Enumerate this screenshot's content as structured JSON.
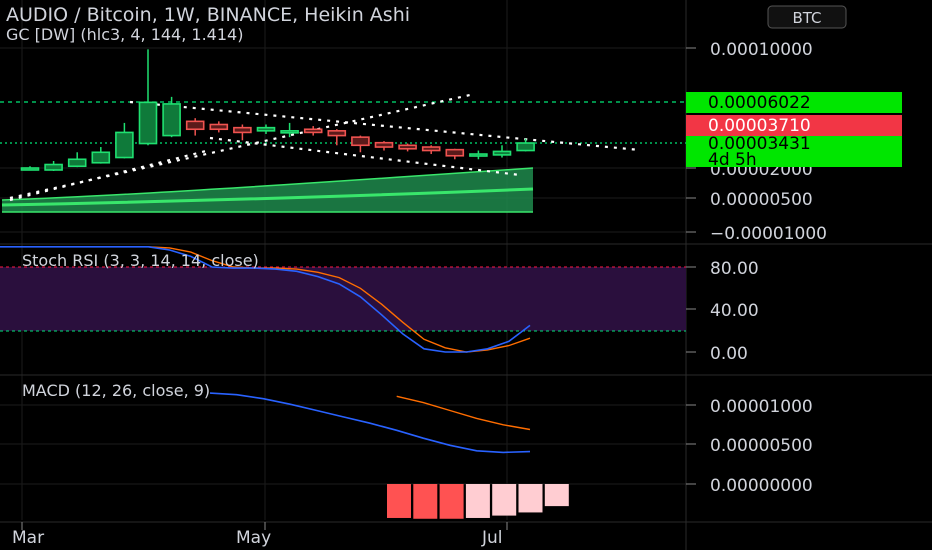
{
  "header": {
    "title": "AUDIO / Bitcoin, 1W, BINANCE, Heikin Ashi",
    "indicator": "GC [DW] (hlc3, 4, 144, 1.414)",
    "currency_button": "BTC"
  },
  "colors": {
    "background": "#000000",
    "up": "#26a69a",
    "down": "#ef5350",
    "guppy_band": "#1f8a4c",
    "guppy_line": "#39e66b",
    "stoch_k": "#2962ff",
    "stoch_d": "#ff6d00",
    "stoch_band": "#2a0f3d",
    "macd_line": "#2962ff",
    "signal_line": "#ff6d00",
    "hist_dark": "#ff5252",
    "hist_light": "#ffcdd2",
    "level_green": "#00e676",
    "last_price_red": "#f23645",
    "current_green": "#00e600"
  },
  "price_axis": {
    "ticks": [
      "0.00010000",
      "0.00002000",
      "0.00000500",
      "−0.00001000"
    ]
  },
  "badges": {
    "level": "0.00006022",
    "high": "0.00003710",
    "current": "0.00003431",
    "countdown": "4d 5h"
  },
  "stoch": {
    "title": "Stoch RSI (3, 3, 14, 14, close)",
    "ticks": [
      "80.00",
      "40.00",
      "0.00"
    ]
  },
  "macd": {
    "title": "MACD (12, 26, close, 9)",
    "ticks": [
      "0.00001000",
      "0.00000500",
      "0.00000000"
    ]
  },
  "time_axis": {
    "labels": [
      "Mar",
      "May",
      "Jul"
    ]
  },
  "chart_data": [
    {
      "type": "candlestick",
      "title": "AUDIO / Bitcoin, 1W, BINANCE, Heikin Ashi",
      "ylim": [
        -1e-05,
        0.00011
      ],
      "y_scale": "log",
      "candles": [
        {
          "o": 1.95e-05,
          "c": 2e-05,
          "h": 2.1e-05,
          "l": 1.9e-05
        },
        {
          "o": 1.9e-05,
          "c": 2.2e-05,
          "h": 2.4e-05,
          "l": 1.85e-05
        },
        {
          "o": 2.1e-05,
          "c": 2.5e-05,
          "h": 2.9e-05,
          "l": 2.05e-05
        },
        {
          "o": 2.3e-05,
          "c": 2.9e-05,
          "h": 3.2e-05,
          "l": 2.25e-05
        },
        {
          "o": 2.6e-05,
          "c": 4.1e-05,
          "h": 4.7e-05,
          "l": 2.55e-05
        },
        {
          "o": 3.4e-05,
          "c": 6e-05,
          "h": 9.9e-05,
          "l": 3.3e-05
        },
        {
          "o": 3.9e-05,
          "c": 5.9e-05,
          "h": 6.4e-05,
          "l": 3.8e-05
        },
        {
          "o": 4.8e-05,
          "c": 4.3e-05,
          "h": 5e-05,
          "l": 3.9e-05
        },
        {
          "o": 4.6e-05,
          "c": 4.3e-05,
          "h": 4.8e-05,
          "l": 4.1e-05
        },
        {
          "o": 4.4e-05,
          "c": 4.1e-05,
          "h": 4.6e-05,
          "l": 3.6e-05
        },
        {
          "o": 4.2e-05,
          "c": 4.4e-05,
          "h": 4.6e-05,
          "l": 4e-05
        },
        {
          "o": 4.2e-05,
          "c": 4.2e-05,
          "h": 4.7e-05,
          "l": 3.8e-05
        },
        {
          "o": 4.3e-05,
          "c": 4.1e-05,
          "h": 4.5e-05,
          "l": 3.9e-05
        },
        {
          "o": 4.2e-05,
          "c": 3.9e-05,
          "h": 4.3e-05,
          "l": 3.3e-05
        },
        {
          "o": 3.8e-05,
          "c": 3.3e-05,
          "h": 3.9e-05,
          "l": 2.9e-05
        },
        {
          "o": 3.45e-05,
          "c": 3.2e-05,
          "h": 3.55e-05,
          "l": 3e-05
        },
        {
          "o": 3.3e-05,
          "c": 3.1e-05,
          "h": 3.4e-05,
          "l": 2.95e-05
        },
        {
          "o": 3.2e-05,
          "c": 3e-05,
          "h": 3.3e-05,
          "l": 2.8e-05
        },
        {
          "o": 3.05e-05,
          "c": 2.7e-05,
          "h": 3.1e-05,
          "l": 2.5e-05
        },
        {
          "o": 2.7e-05,
          "c": 2.8e-05,
          "h": 3e-05,
          "l": 2.5e-05
        },
        {
          "o": 2.75e-05,
          "c": 2.95e-05,
          "h": 3.3e-05,
          "l": 2.6e-05
        },
        {
          "o": 3e-05,
          "c": 3.43e-05,
          "h": 3.71e-05,
          "l": 2.95e-05
        }
      ],
      "horizontal_levels": [
        6.022e-05,
        3.431e-05
      ]
    },
    {
      "type": "line",
      "title": "Stoch RSI (3, 3, 14, 14, close)",
      "ylim": [
        0,
        100
      ],
      "bands": [
        20,
        80
      ],
      "series": [
        {
          "name": "K",
          "values": [
            99,
            99,
            99,
            99,
            99,
            99,
            99,
            99,
            96,
            90,
            80,
            79,
            79,
            78,
            76,
            71,
            64,
            52,
            35,
            17,
            3,
            0,
            0,
            3,
            10,
            25
          ]
        },
        {
          "name": "D",
          "values": [
            99,
            99,
            99,
            99,
            99,
            99,
            99,
            99,
            98,
            94,
            86,
            80,
            79,
            79,
            78,
            75,
            70,
            60,
            45,
            28,
            12,
            4,
            0,
            2,
            6,
            13
          ]
        }
      ]
    },
    {
      "type": "bar",
      "title": "MACD (12, 26, close, 9)",
      "ylim": [
        -1.5e-06,
        1.2e-05
      ],
      "series": [
        {
          "name": "MACD",
          "values": [
            1.15e-05,
            1.13e-05,
            1.08e-05,
            1.01e-05,
            9.3e-06,
            8.5e-06,
            7.7e-06,
            6.8e-06,
            5.8e-06,
            4.9e-06,
            4.2e-06,
            4e-06,
            4.1e-06
          ]
        },
        {
          "name": "Signal",
          "values": [
            null,
            null,
            null,
            null,
            null,
            null,
            null,
            1.11e-05,
            1.03e-05,
            9.3e-06,
            8.3e-06,
            7.5e-06,
            6.9e-06
          ]
        },
        {
          "name": "Histogram",
          "values": [
            -4.3e-06,
            -4.4e-06,
            -4.4e-06,
            -4.3e-06,
            -4e-06,
            -3.6e-06,
            -2.8e-06
          ]
        }
      ]
    }
  ]
}
